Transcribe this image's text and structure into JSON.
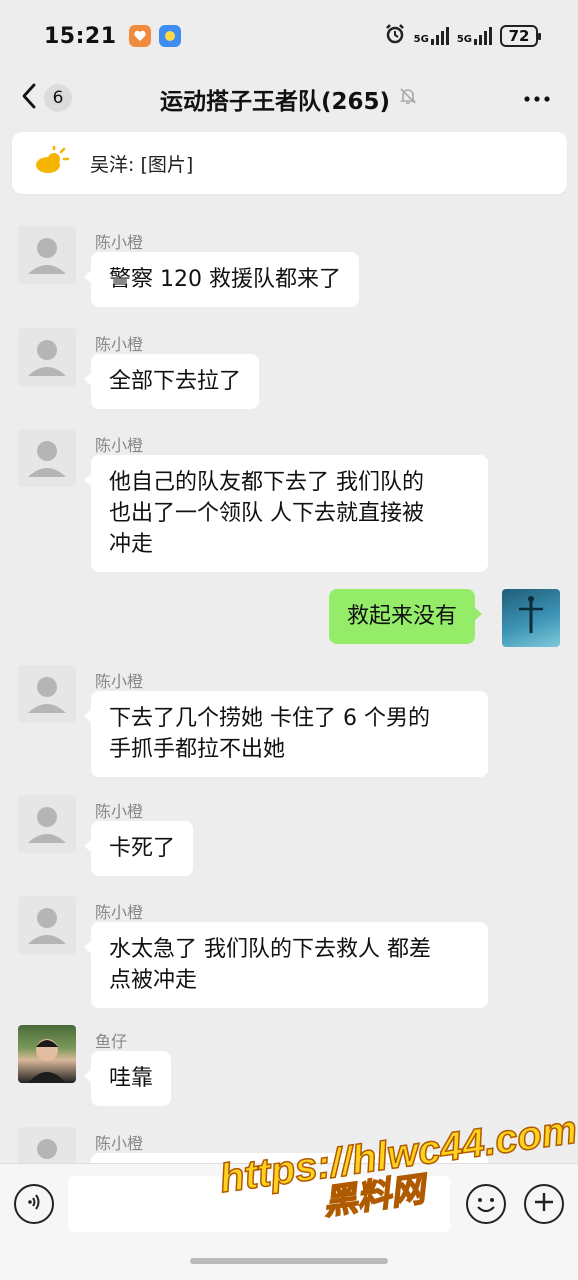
{
  "status_bar": {
    "time": "15:21",
    "network_1": "5G",
    "network_2": "5G",
    "battery": "72"
  },
  "header": {
    "back_count": "6",
    "title": "运动搭子王者队(265)"
  },
  "pinned": {
    "text": "吴洋: [图片]"
  },
  "messages": [
    {
      "sender": "陈小橙",
      "text": "警察 120 救援队都来了"
    },
    {
      "sender": "陈小橙",
      "text": "全部下去拉了"
    },
    {
      "sender": "陈小橙",
      "line1": "他自己的队友都下去了 我们队的",
      "line2": "也出了一个领队  人下去就直接被",
      "line3": "冲走"
    },
    {
      "self": true,
      "text": "救起来没有"
    },
    {
      "sender": "陈小橙",
      "line1": "下去了几个捞她  卡住了 6 个男的",
      "line2": "手抓手都拉不出她"
    },
    {
      "sender": "陈小橙",
      "text": "卡死了"
    },
    {
      "sender": "陈小橙",
      "line1": "水太急了 我们队的下去救人 都差",
      "line2": "点被冲走"
    },
    {
      "sender": "鱼仔",
      "text": "哇靠"
    },
    {
      "sender": "陈小橙",
      "text": ""
    }
  ],
  "watermark": {
    "line1": "https://hlwc44.com",
    "line2": "黑料网"
  },
  "colors": {
    "background": "#ededed",
    "self_bubble": "#95ec69",
    "other_bubble": "#ffffff"
  }
}
